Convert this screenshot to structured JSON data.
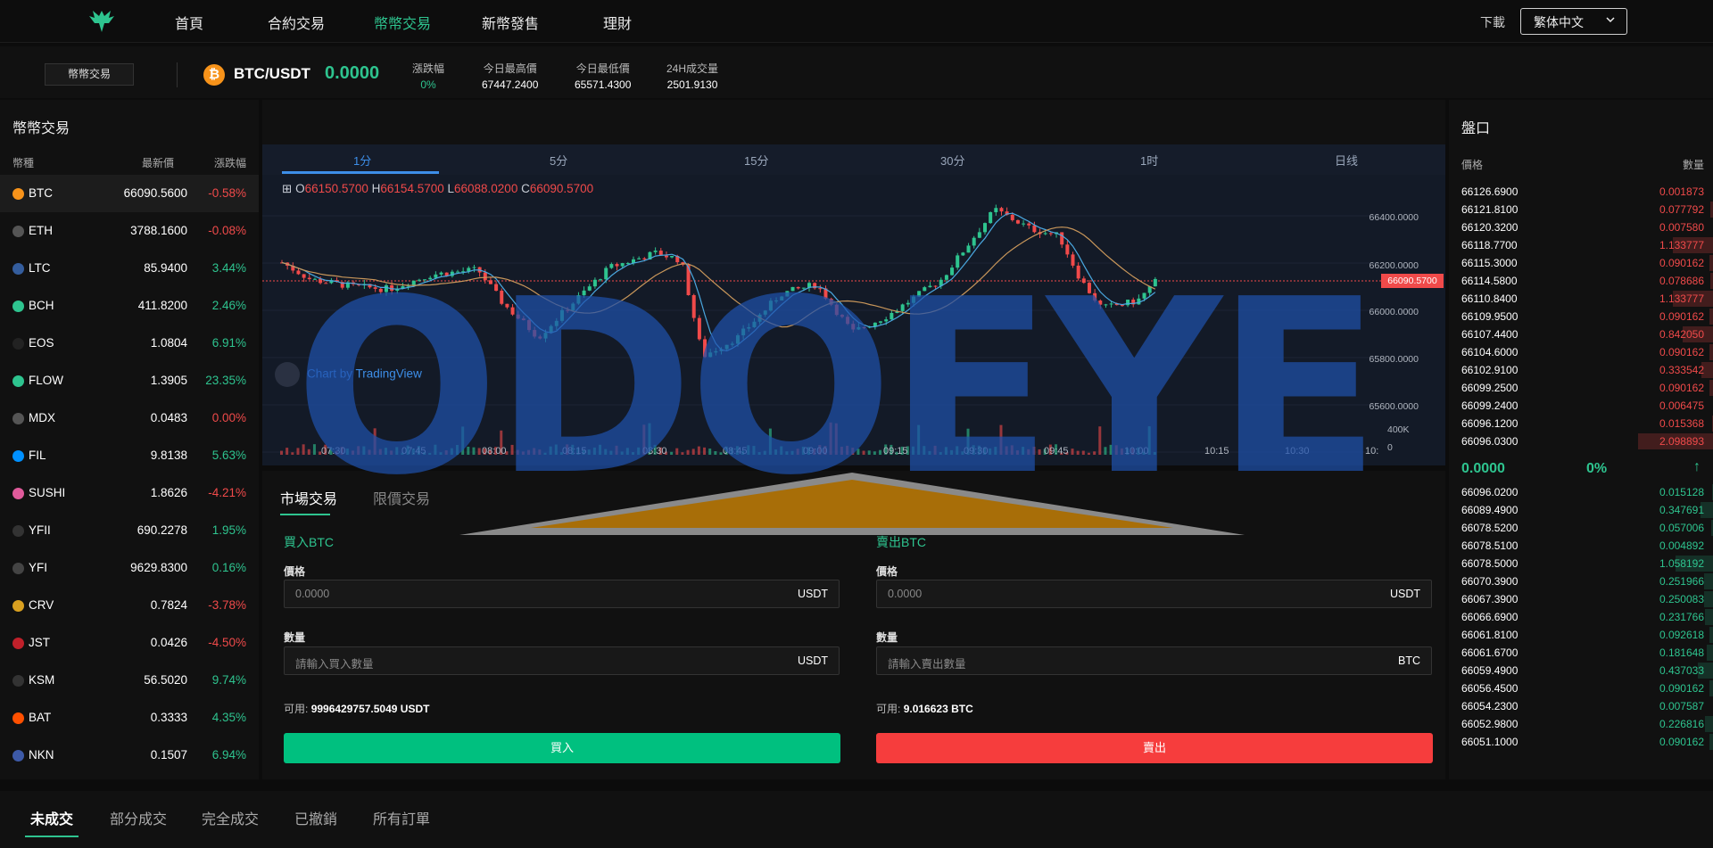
{
  "nav": {
    "items": [
      "首頁",
      "合約交易",
      "幣幣交易",
      "新幣發售",
      "理財"
    ],
    "active_index": 2,
    "download": "下載",
    "language": "繁体中文"
  },
  "ticker": {
    "spot_button": "幣幣交易",
    "pair": "BTC/USDT",
    "price": "0.0000",
    "stats": [
      {
        "label": "漲跌幅",
        "value": "0%"
      },
      {
        "label": "今日最高價",
        "value": "67447.2400"
      },
      {
        "label": "今日最低價",
        "value": "65571.4300"
      },
      {
        "label": "24H成交量",
        "value": "2501.9130"
      }
    ]
  },
  "markets": {
    "title": "幣幣交易",
    "headers": [
      "幣種",
      "最新價",
      "漲跌幅"
    ],
    "rows": [
      {
        "sym": "BTC",
        "price": "66090.5600",
        "chg": "-0.58%",
        "dir": "down",
        "color": "#f7931a"
      },
      {
        "sym": "ETH",
        "price": "3788.1600",
        "chg": "-0.08%",
        "dir": "down",
        "color": "#555555"
      },
      {
        "sym": "LTC",
        "price": "85.9400",
        "chg": "3.44%",
        "dir": "up",
        "color": "#345d9d"
      },
      {
        "sym": "BCH",
        "price": "411.8200",
        "chg": "2.46%",
        "dir": "up",
        "color": "#2ec48f"
      },
      {
        "sym": "EOS",
        "price": "1.0804",
        "chg": "6.91%",
        "dir": "up",
        "color": "#222222"
      },
      {
        "sym": "FLOW",
        "price": "1.3905",
        "chg": "23.35%",
        "dir": "up",
        "color": "#2ec48f"
      },
      {
        "sym": "MDX",
        "price": "0.0483",
        "chg": "0.00%",
        "dir": "down",
        "color": "#555555"
      },
      {
        "sym": "FIL",
        "price": "9.8138",
        "chg": "5.63%",
        "dir": "up",
        "color": "#0090ff"
      },
      {
        "sym": "SUSHI",
        "price": "1.8626",
        "chg": "-4.21%",
        "dir": "down",
        "color": "#e05a9b"
      },
      {
        "sym": "YFII",
        "price": "690.2278",
        "chg": "1.95%",
        "dir": "up",
        "color": "#333333"
      },
      {
        "sym": "YFI",
        "price": "9629.8300",
        "chg": "0.16%",
        "dir": "up",
        "color": "#444444"
      },
      {
        "sym": "CRV",
        "price": "0.7824",
        "chg": "-3.78%",
        "dir": "down",
        "color": "#d9a020"
      },
      {
        "sym": "JST",
        "price": "0.0426",
        "chg": "-4.50%",
        "dir": "down",
        "color": "#c0202a"
      },
      {
        "sym": "KSM",
        "price": "56.5020",
        "chg": "9.74%",
        "dir": "up",
        "color": "#333333"
      },
      {
        "sym": "BAT",
        "price": "0.3333",
        "chg": "4.35%",
        "dir": "up",
        "color": "#ff5000"
      },
      {
        "sym": "NKN",
        "price": "0.1507",
        "chg": "6.94%",
        "dir": "up",
        "color": "#3d5aa8"
      }
    ]
  },
  "chart": {
    "timeframes": [
      "1分",
      "5分",
      "15分",
      "30分",
      "1时",
      "日线"
    ],
    "ohlc": {
      "o": "66150.5700",
      "h": "66154.5700",
      "l": "66088.0200",
      "c": "66090.5700"
    },
    "tv_label": "Chart by TradingView",
    "y_ticks": [
      "66400.0000",
      "66200.0000",
      "66000.0000",
      "65800.0000",
      "65600.0000",
      "400K",
      "0"
    ],
    "x_ticks": [
      "07:30",
      "07:45",
      "08:00",
      "08:15",
      "08:30",
      "08:45",
      "09:00",
      "09:15",
      "09:30",
      "09:45",
      "10:00",
      "10:15",
      "10:30",
      "10:"
    ],
    "last_price": "66090.5700"
  },
  "trade": {
    "tabs": [
      "市場交易",
      "限價交易"
    ],
    "buy": {
      "head": "買入BTC",
      "price_label": "價格",
      "price_placeholder": "0.0000",
      "price_unit": "USDT",
      "qty_label": "數量",
      "qty_placeholder": "請輸入買入數量",
      "qty_unit": "USDT",
      "avail_label": "可用:",
      "avail_value": "9996429757.5049 USDT",
      "button": "買入"
    },
    "sell": {
      "head": "賣出BTC",
      "price_label": "價格",
      "price_placeholder": "0.0000",
      "price_unit": "USDT",
      "qty_label": "數量",
      "qty_placeholder": "請輸入賣出數量",
      "qty_unit": "BTC",
      "avail_label": "可用:",
      "avail_value": "9.016623 BTC",
      "button": "賣出"
    }
  },
  "book": {
    "title": "盤口",
    "headers": [
      "價格",
      "數量"
    ],
    "asks": [
      [
        "66126.6900",
        "0.001873"
      ],
      [
        "66121.8100",
        "0.077792"
      ],
      [
        "66120.3200",
        "0.007580"
      ],
      [
        "66118.7700",
        "1.133777"
      ],
      [
        "66115.3000",
        "0.090162"
      ],
      [
        "66114.5800",
        "0.078686"
      ],
      [
        "66110.8400",
        "1.133777"
      ],
      [
        "66109.9500",
        "0.090162"
      ],
      [
        "66107.4400",
        "0.842050"
      ],
      [
        "66104.6000",
        "0.090162"
      ],
      [
        "66102.9100",
        "0.333542"
      ],
      [
        "66099.2500",
        "0.090162"
      ],
      [
        "66099.2400",
        "0.006475"
      ],
      [
        "66096.1200",
        "0.015368"
      ],
      [
        "66096.0300",
        "2.098893"
      ]
    ],
    "mid_price": "0.0000",
    "mid_pct": "0%",
    "bids": [
      [
        "66096.0200",
        "0.015128"
      ],
      [
        "66089.4900",
        "0.347691"
      ],
      [
        "66078.5200",
        "0.057006"
      ],
      [
        "66078.5100",
        "0.004892"
      ],
      [
        "66078.5000",
        "1.058192"
      ],
      [
        "66070.3900",
        "0.251966"
      ],
      [
        "66067.3900",
        "0.250083"
      ],
      [
        "66066.6900",
        "0.231766"
      ],
      [
        "66061.8100",
        "0.092618"
      ],
      [
        "66061.6700",
        "0.181648"
      ],
      [
        "66059.4900",
        "0.437033"
      ],
      [
        "66056.4500",
        "0.090162"
      ],
      [
        "66054.2300",
        "0.007587"
      ],
      [
        "66052.9800",
        "0.226816"
      ],
      [
        "66051.1000",
        "0.090162"
      ]
    ]
  },
  "orders": {
    "tabs": [
      "未成交",
      "部分成交",
      "完全成交",
      "已撤銷",
      "所有訂單"
    ]
  },
  "watermark": "ODOEYE"
}
